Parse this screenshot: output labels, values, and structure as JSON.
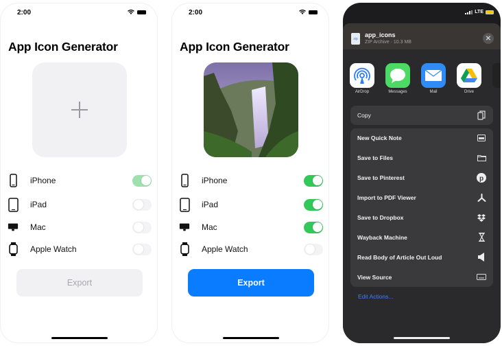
{
  "screens": [
    {
      "status_time": "2:00",
      "title": "App Icon Generator",
      "icon_state": "empty",
      "devices": [
        {
          "label": "iPhone",
          "icon": "iphone-icon",
          "on": true
        },
        {
          "label": "iPad",
          "icon": "ipad-icon",
          "on": false
        },
        {
          "label": "Mac",
          "icon": "mac-icon",
          "on": false
        },
        {
          "label": "Apple Watch",
          "icon": "apple-watch-icon",
          "on": false
        }
      ],
      "export_label": "Export",
      "export_enabled": false
    },
    {
      "status_time": "2:00",
      "title": "App Icon Generator",
      "icon_state": "waterfall-photo",
      "devices": [
        {
          "label": "iPhone",
          "icon": "iphone-icon",
          "on": true
        },
        {
          "label": "iPad",
          "icon": "ipad-icon",
          "on": true
        },
        {
          "label": "Mac",
          "icon": "mac-icon",
          "on": true
        },
        {
          "label": "Apple Watch",
          "icon": "apple-watch-icon",
          "on": false
        }
      ],
      "export_label": "Export",
      "export_enabled": true
    }
  ],
  "share_sheet": {
    "status": {
      "network": "LTE"
    },
    "file": {
      "name": "app_icons",
      "meta": "ZIP Archive · 10.3 MB",
      "icon_text": "zip"
    },
    "close_label": "✕",
    "apps": [
      {
        "label": "AirDrop",
        "icon": "airdrop-icon"
      },
      {
        "label": "Messages",
        "icon": "messages-icon"
      },
      {
        "label": "Mail",
        "icon": "mail-icon"
      },
      {
        "label": "Drive",
        "icon": "google-drive-icon"
      }
    ],
    "copy_label": "Copy",
    "actions": [
      {
        "label": "New Quick Note",
        "icon": "quick-note-icon"
      },
      {
        "label": "Save to Files",
        "icon": "folder-icon"
      },
      {
        "label": "Save to Pinterest",
        "icon": "pinterest-icon"
      },
      {
        "label": "Import to PDF Viewer",
        "icon": "pdf-viewer-icon"
      },
      {
        "label": "Save to Dropbox",
        "icon": "dropbox-icon"
      },
      {
        "label": "Wayback Machine",
        "icon": "hourglass-icon"
      },
      {
        "label": "Read Body of Article Out Loud",
        "icon": "speaker-icon"
      },
      {
        "label": "View Source",
        "icon": "keyboard-icon"
      }
    ],
    "edit_actions_label": "Edit Actions..."
  },
  "colors": {
    "accent": "#0a7cff",
    "toggle_on": "#34c759",
    "link": "#3b82f6"
  }
}
